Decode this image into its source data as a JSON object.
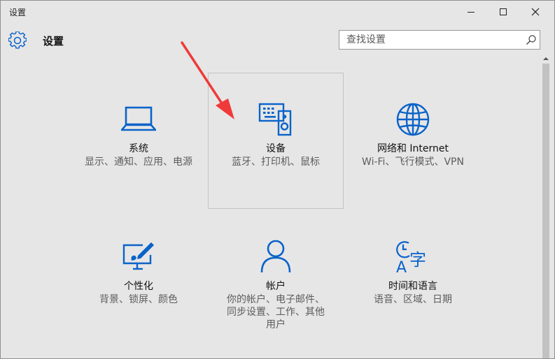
{
  "window": {
    "title": "设置"
  },
  "header": {
    "title": "设置"
  },
  "search": {
    "placeholder": "查找设置",
    "value": ""
  },
  "tiles": [
    {
      "label": "系统",
      "desc": "显示、通知、应用、电源",
      "icon": "laptop-icon"
    },
    {
      "label": "设备",
      "desc": "蓝牙、打印机、鼠标",
      "icon": "devices-icon"
    },
    {
      "label": "网络和 Internet",
      "desc": "Wi-Fi、飞行模式、VPN",
      "icon": "globe-icon"
    },
    {
      "label": "个性化",
      "desc": "背景、锁屏、颜色",
      "icon": "personalization-icon"
    },
    {
      "label": "帐户",
      "desc": "你的帐户、电子邮件、同步设置、工作、其他用户",
      "icon": "person-icon"
    },
    {
      "label": "时间和语言",
      "desc": "语音、区域、日期",
      "icon": "time-language-icon"
    }
  ],
  "colors": {
    "accent": "#0a63c9",
    "window_bg": "#e6e6e6",
    "annotation_arrow": "#f03a3a"
  }
}
